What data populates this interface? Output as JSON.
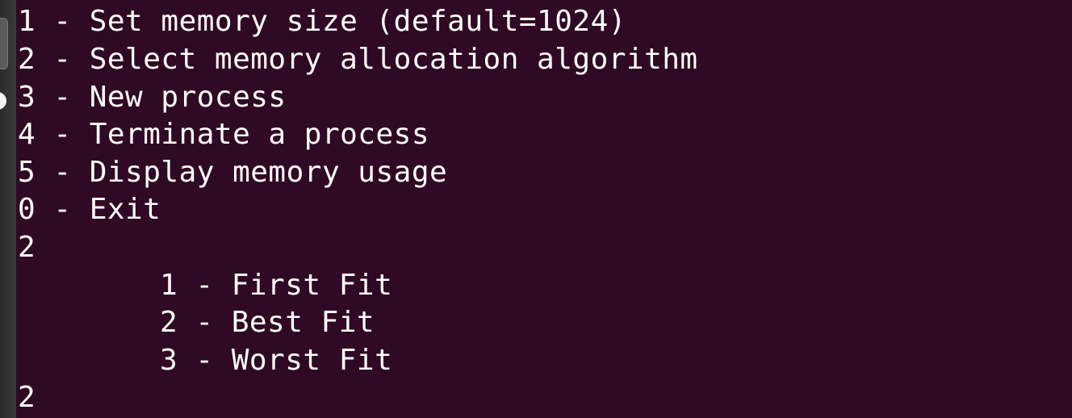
{
  "terminal": {
    "menu": [
      "1 - Set memory size (default=1024)",
      "2 - Select memory allocation algorithm",
      "3 - New process",
      "4 - Terminate a process",
      "5 - Display memory usage",
      "0 - Exit"
    ],
    "input_1": "2",
    "submenu": [
      "1 - First Fit",
      "2 - Best Fit",
      "3 - Worst Fit"
    ],
    "input_2": "2"
  },
  "colors": {
    "background": "#300a24",
    "text": "#ffffff"
  }
}
